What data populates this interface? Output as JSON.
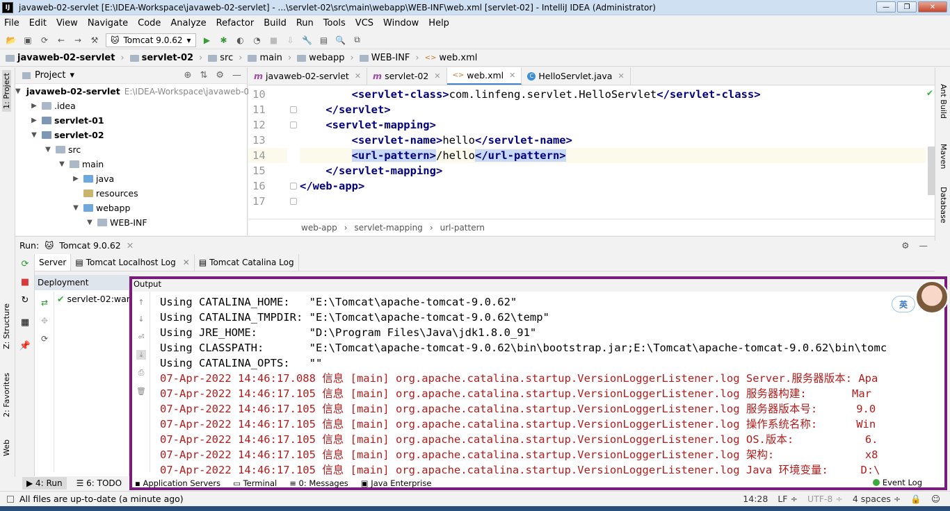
{
  "window": {
    "title": "javaweb-02-servlet [E:\\IDEA-Workspace\\javaweb-02-servlet] - ...\\servlet-02\\src\\main\\webapp\\WEB-INF\\web.xml [servlet-02] - IntelliJ IDEA (Administrator)",
    "app_icon": "IJ",
    "buttons": {
      "minimize": "—",
      "maximize": "❐",
      "close": "✕"
    }
  },
  "menu": [
    "File",
    "Edit",
    "View",
    "Navigate",
    "Code",
    "Analyze",
    "Refactor",
    "Build",
    "Run",
    "Tools",
    "VCS",
    "Window",
    "Help"
  ],
  "toolbar": {
    "run_config": "Tomcat 9.0.62"
  },
  "breadcrumb": [
    "javaweb-02-servlet",
    "servlet-02",
    "src",
    "main",
    "webapp",
    "WEB-INF",
    "web.xml"
  ],
  "left_strip": {
    "project": "1: Project",
    "structure": "Z: Structure",
    "favorites": "2: Favorites",
    "web": "Web"
  },
  "right_strip": {
    "ant": "Ant Build",
    "maven": "Maven",
    "database": "Database"
  },
  "project": {
    "header": "Project",
    "tree": [
      {
        "label": "javaweb-02-servlet",
        "path": "E:\\IDEA-Workspace\\javaweb-0",
        "bold": true
      },
      {
        "label": ".idea",
        "bold": false
      },
      {
        "label": "servlet-01",
        "bold": true
      },
      {
        "label": "servlet-02",
        "bold": true
      },
      {
        "label": "src",
        "bold": false
      },
      {
        "label": "main",
        "bold": false
      },
      {
        "label": "java",
        "bold": false
      },
      {
        "label": "resources",
        "bold": false
      },
      {
        "label": "webapp",
        "bold": false
      },
      {
        "label": "WEB-INF",
        "bold": false
      }
    ]
  },
  "editor": {
    "tabs": [
      {
        "label": "javaweb-02-servlet",
        "icon": "m"
      },
      {
        "label": "servlet-02",
        "icon": "m"
      },
      {
        "label": "web.xml",
        "icon": "<>"
      },
      {
        "label": "HelloServlet.java",
        "icon": "C"
      }
    ],
    "line_numbers": [
      "10",
      "11",
      "12",
      "13",
      "14",
      "15",
      "16",
      "17"
    ],
    "lines": {
      "l10": {
        "open": "<servlet-class>",
        "text": "com.linfeng.servlet.HelloServlet",
        "close": "</servlet-class>"
      },
      "l11": "</servlet>",
      "l12": "<servlet-mapping>",
      "l13": {
        "open": "<servlet-name>",
        "text": "hello",
        "close": "</servlet-name>"
      },
      "l14": {
        "open": "<url-pattern>",
        "text": "/hello",
        "close": "</url-pattern>"
      },
      "l15": "</servlet-mapping>",
      "l16": "</web-app>"
    },
    "breadcrumb": [
      "web-app",
      "servlet-mapping",
      "url-pattern"
    ]
  },
  "run": {
    "label": "Run:",
    "config": "Tomcat 9.0.62",
    "tabs": [
      "Server",
      "Tomcat Localhost Log",
      "Tomcat Catalina Log"
    ],
    "deployment_header": "Deployment",
    "output_header": "Output",
    "deployment_item": "servlet-02:war",
    "output_lines": [
      "Using CATALINA_HOME:   \"E:\\Tomcat\\apache-tomcat-9.0.62\"",
      "Using CATALINA_TMPDIR: \"E:\\Tomcat\\apache-tomcat-9.0.62\\temp\"",
      "Using JRE_HOME:        \"D:\\Program Files\\Java\\jdk1.8.0_91\"",
      "Using CLASSPATH:       \"E:\\Tomcat\\apache-tomcat-9.0.62\\bin\\bootstrap.jar;E:\\Tomcat\\apache-tomcat-9.0.62\\bin\\tomc",
      "Using CATALINA_OPTS:   \"\""
    ],
    "log_lines": [
      "07-Apr-2022 14:46:17.088 信息 [main] org.apache.catalina.startup.VersionLoggerListener.log Server.服务器版本: Apa",
      "07-Apr-2022 14:46:17.105 信息 [main] org.apache.catalina.startup.VersionLoggerListener.log 服务器构建:       Mar",
      "07-Apr-2022 14:46:17.105 信息 [main] org.apache.catalina.startup.VersionLoggerListener.log 服务器版本号:      9.0",
      "07-Apr-2022 14:46:17.105 信息 [main] org.apache.catalina.startup.VersionLoggerListener.log 操作系统名称:      Win",
      "07-Apr-2022 14:46:17.105 信息 [main] org.apache.catalina.startup.VersionLoggerListener.log OS.版本:           6.",
      "07-Apr-2022 14:46:17.105 信息 [main] org.apache.catalina.startup.VersionLoggerListener.log 架构:              x8",
      "07-Apr-2022 14:46:17.105 信息 [main] org.apache.catalina.startup.VersionLoggerListener.log Java 环境变量:     D:\\"
    ],
    "ime_badge": "英"
  },
  "bottom_tabs": {
    "run": "4: Run",
    "todo": "6: TODO",
    "app_servers": "Application Servers",
    "terminal": "Terminal",
    "messages": "0: Messages",
    "java_ent": "Java Enterprise",
    "event_log": "Event Log"
  },
  "status": {
    "message": "All files are up-to-date (a minute ago)",
    "position": "14:28",
    "line_sep": "LF ÷",
    "encoding": "UTF-8 ÷",
    "indent": "4 spaces ÷"
  },
  "colors": {
    "highlight_border": "#7a1c7a",
    "tag": "#000080",
    "log_red": "#b31b1b"
  }
}
